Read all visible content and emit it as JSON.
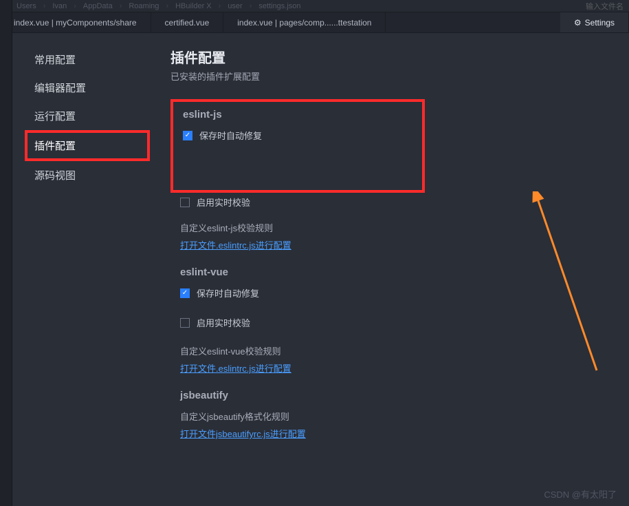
{
  "breadcrumb": {
    "items": [
      "Users",
      "Ivan",
      "AppData",
      "Roaming",
      "HBuilder X",
      "user",
      "settings.json"
    ],
    "right": "输入文件名"
  },
  "tabs": {
    "t0": "index.vue | myComponents/share",
    "t1": "certified.vue",
    "t2": "index.vue | pages/comp......ttestation",
    "t3": "Settings"
  },
  "sidebar": {
    "items": {
      "s0": "常用配置",
      "s1": "编辑器配置",
      "s2": "运行配置",
      "s3": "插件配置",
      "s4": "源码视图"
    }
  },
  "content": {
    "title": "插件配置",
    "subtitle": "已安装的插件扩展配置",
    "eslint_js": {
      "head": "eslint-js",
      "autofix": "保存时自动修复",
      "realtime": "启用实时校验",
      "rule_label": "自定义eslint-js校验规则",
      "rule_link": "打开文件.eslintrc.js进行配置"
    },
    "eslint_vue": {
      "head": "eslint-vue",
      "autofix": "保存时自动修复",
      "realtime": "启用实时校验",
      "rule_label": "自定义eslint-vue校验规则",
      "rule_link": "打开文件.eslintrc.js进行配置"
    },
    "jsb": {
      "head": "jsbeautify",
      "rule_label": "自定义jsbeautify格式化规则",
      "rule_link": "打开文件jsbeautifyrc.js进行配置"
    }
  },
  "watermark": "CSDN @有太阳了"
}
